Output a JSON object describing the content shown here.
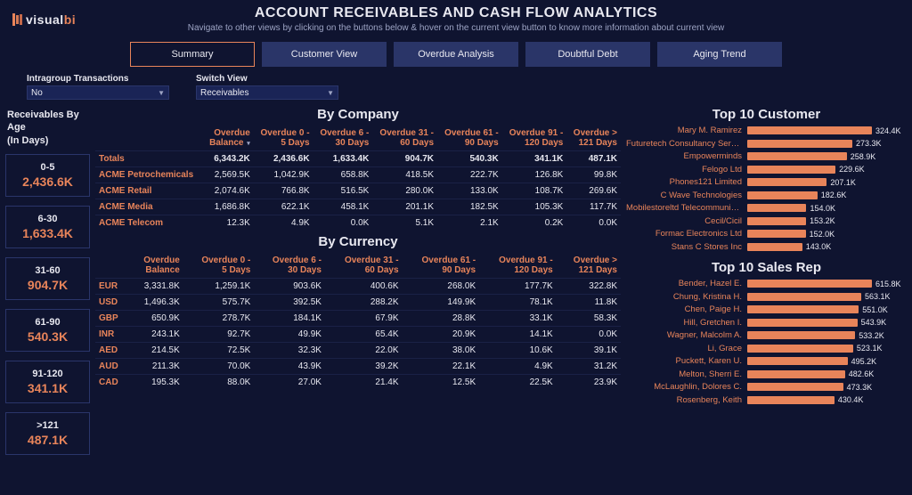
{
  "brand": {
    "name_a": "visual",
    "name_b": "bi"
  },
  "title": "ACCOUNT RECEIVABLES AND CASH FLOW ANALYTICS",
  "subtitle": "Navigate to other views by clicking on the buttons below & hover on the current view button to know more information about current view",
  "tabs": [
    "Summary",
    "Customer View",
    "Overdue Analysis",
    "Doubtful Debt",
    "Aging Trend"
  ],
  "active_tab": 0,
  "filters": {
    "intragroup": {
      "label": "Intragroup Transactions",
      "value": "No"
    },
    "switch": {
      "label": "Switch View",
      "value": "Receivables"
    }
  },
  "age_title_lines": [
    "Receivables By",
    "Age",
    "(In Days)"
  ],
  "age": [
    {
      "range": "0-5",
      "value": "2,436.6K"
    },
    {
      "range": "6-30",
      "value": "1,633.4K"
    },
    {
      "range": "31-60",
      "value": "904.7K"
    },
    {
      "range": "61-90",
      "value": "540.3K"
    },
    {
      "range": "91-120",
      "value": "341.1K"
    },
    {
      "range": ">121",
      "value": "487.1K"
    }
  ],
  "columns": [
    "Overdue Balance",
    "Overdue 0 - 5 Days",
    "Overdue 6 - 30 Days",
    "Overdue 31 - 60 Days",
    "Overdue 61 - 90 Days",
    "Overdue 91 - 120 Days",
    "Overdue > 121 Days"
  ],
  "company_title": "By Company",
  "company_rows": [
    {
      "label": "Totals",
      "cells": [
        "6,343.2K",
        "2,436.6K",
        "1,633.4K",
        "904.7K",
        "540.3K",
        "341.1K",
        "487.1K"
      ],
      "totals": true
    },
    {
      "label": "ACME Petrochemicals",
      "cells": [
        "2,569.5K",
        "1,042.9K",
        "658.8K",
        "418.5K",
        "222.7K",
        "126.8K",
        "99.8K"
      ]
    },
    {
      "label": "ACME Retail",
      "cells": [
        "2,074.6K",
        "766.8K",
        "516.5K",
        "280.0K",
        "133.0K",
        "108.7K",
        "269.6K"
      ]
    },
    {
      "label": "ACME Media",
      "cells": [
        "1,686.8K",
        "622.1K",
        "458.1K",
        "201.1K",
        "182.5K",
        "105.3K",
        "117.7K"
      ]
    },
    {
      "label": "ACME Telecom",
      "cells": [
        "12.3K",
        "4.9K",
        "0.0K",
        "5.1K",
        "2.1K",
        "0.2K",
        "0.0K"
      ]
    }
  ],
  "currency_title": "By Currency",
  "currency_rows": [
    {
      "label": "EUR",
      "cells": [
        "3,331.8K",
        "1,259.1K",
        "903.6K",
        "400.6K",
        "268.0K",
        "177.7K",
        "322.8K"
      ]
    },
    {
      "label": "USD",
      "cells": [
        "1,496.3K",
        "575.7K",
        "392.5K",
        "288.2K",
        "149.9K",
        "78.1K",
        "11.8K"
      ]
    },
    {
      "label": "GBP",
      "cells": [
        "650.9K",
        "278.7K",
        "184.1K",
        "67.9K",
        "28.8K",
        "33.1K",
        "58.3K"
      ]
    },
    {
      "label": "INR",
      "cells": [
        "243.1K",
        "92.7K",
        "49.9K",
        "65.4K",
        "20.9K",
        "14.1K",
        "0.0K"
      ]
    },
    {
      "label": "AED",
      "cells": [
        "214.5K",
        "72.5K",
        "32.3K",
        "22.0K",
        "38.0K",
        "10.6K",
        "39.1K"
      ]
    },
    {
      "label": "AUD",
      "cells": [
        "211.3K",
        "70.0K",
        "43.9K",
        "39.2K",
        "22.1K",
        "4.9K",
        "31.2K"
      ]
    },
    {
      "label": "CAD",
      "cells": [
        "195.3K",
        "88.0K",
        "27.0K",
        "21.4K",
        "12.5K",
        "22.5K",
        "23.9K"
      ]
    }
  ],
  "top_customer_title": "Top 10 Customer",
  "top_salesrep_title": "Top 10 Sales Rep",
  "chart_data": {
    "top_customers": {
      "type": "bar",
      "orientation": "horizontal",
      "max": 324.4,
      "items": [
        {
          "label": "Mary M. Ramirez",
          "value": 324.4,
          "display": "324.4K"
        },
        {
          "label": "Futuretech Consultancy Services",
          "value": 273.3,
          "display": "273.3K"
        },
        {
          "label": "Empowerminds",
          "value": 258.9,
          "display": "258.9K"
        },
        {
          "label": "Felogo Ltd",
          "value": 229.6,
          "display": "229.6K"
        },
        {
          "label": "Phones121 Limited",
          "value": 207.1,
          "display": "207.1K"
        },
        {
          "label": "C Wave Technologies",
          "value": 182.6,
          "display": "182.6K"
        },
        {
          "label": "Mobilestoreltd Telecommunication",
          "value": 154.0,
          "display": "154.0K"
        },
        {
          "label": "Cecil/Cicil",
          "value": 153.2,
          "display": "153.2K"
        },
        {
          "label": "Formac Electronics Ltd",
          "value": 152.0,
          "display": "152.0K"
        },
        {
          "label": "Stans C Stores Inc",
          "value": 143.0,
          "display": "143.0K"
        }
      ]
    },
    "top_salesreps": {
      "type": "bar",
      "orientation": "horizontal",
      "max": 615.8,
      "items": [
        {
          "label": "Bender, Hazel E.",
          "value": 615.8,
          "display": "615.8K"
        },
        {
          "label": "Chung, Kristina H.",
          "value": 563.1,
          "display": "563.1K"
        },
        {
          "label": "Chen, Paige H.",
          "value": 551.0,
          "display": "551.0K"
        },
        {
          "label": "Hill, Gretchen I.",
          "value": 543.9,
          "display": "543.9K"
        },
        {
          "label": "Wagner, Malcolm A.",
          "value": 533.2,
          "display": "533.2K"
        },
        {
          "label": "Li, Grace",
          "value": 523.1,
          "display": "523.1K"
        },
        {
          "label": "Puckett, Karen U.",
          "value": 495.2,
          "display": "495.2K"
        },
        {
          "label": "Melton, Sherri E.",
          "value": 482.6,
          "display": "482.6K"
        },
        {
          "label": "McLaughlin, Dolores C.",
          "value": 473.3,
          "display": "473.3K"
        },
        {
          "label": "Rosenberg, Keith",
          "value": 430.4,
          "display": "430.4K"
        }
      ]
    }
  }
}
